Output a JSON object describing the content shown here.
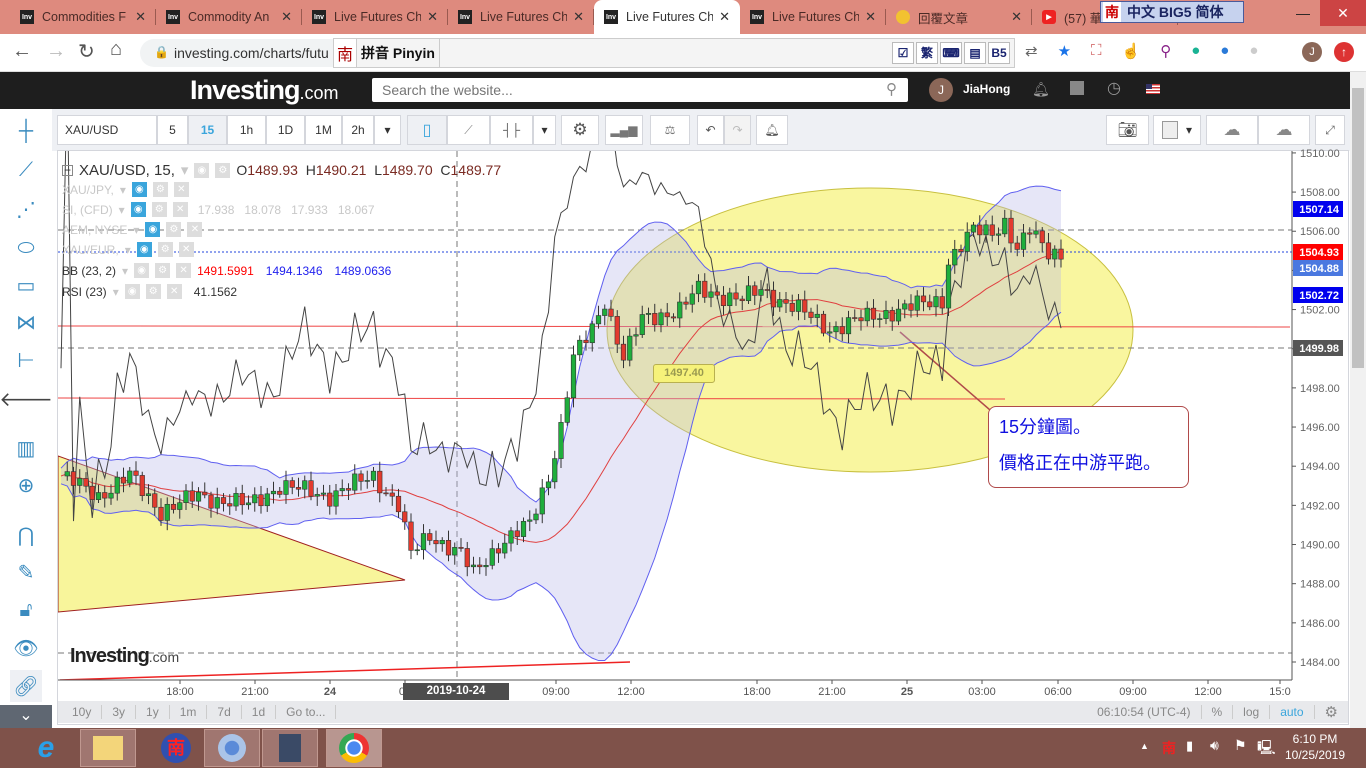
{
  "browser": {
    "tabs": [
      {
        "label": "Commodities F",
        "icon": "inv-icon"
      },
      {
        "label": "Commodity An",
        "icon": "inv-icon"
      },
      {
        "label": "Live Futures Ch",
        "icon": "inv-icon"
      },
      {
        "label": "Live Futures Ch",
        "icon": "inv-icon"
      },
      {
        "label": "Live Futures Ch",
        "icon": "inv-icon",
        "active": true
      },
      {
        "label": "Live Futures Ch",
        "icon": "inv-icon"
      },
      {
        "label": "回覆文章",
        "icon": "gem-icon"
      },
      {
        "label": "(57) 華",
        "icon": "youtube-icon"
      }
    ],
    "ime_bar": "中文 BIG5 简体",
    "ime_logo": "南",
    "url": "investing.com/charts/futu",
    "pinyin_label": "拼音 Pinyin",
    "pinyin_buttons": [
      "☑",
      "繁",
      "⌨",
      "▤",
      "B5"
    ],
    "profile_initial": "J"
  },
  "site": {
    "logo": "Investing",
    "logo_suffix": ".com",
    "search_placeholder": "Search the website...",
    "user_initial": "J",
    "username": "JiaHong"
  },
  "toolbar": {
    "symbol": "XAU/USD",
    "intervals": [
      "5",
      "15",
      "1h",
      "1D",
      "1M",
      "2h"
    ],
    "active_interval": "15"
  },
  "legend": {
    "main": {
      "symbol": "XAU/USD, 15,",
      "o_label": "O",
      "o": "1489.93",
      "h_label": "H",
      "h": "1490.21",
      "l_label": "L",
      "l": "1489.70",
      "c_label": "C",
      "c": "1489.77"
    },
    "compare": [
      {
        "symbol": "XAU/JPY,"
      },
      {
        "symbol": "SI, (CFD)",
        "values": [
          "17.938",
          "18.078",
          "17.933",
          "18.067"
        ]
      },
      {
        "symbol": "AEM, NYSE"
      },
      {
        "symbol": "XAU/EUR,"
      }
    ],
    "bb": {
      "label": "BB (23, 2)",
      "mid": "1491.5991",
      "upper": "1494.1346",
      "lower": "1489.0636"
    },
    "rsi": {
      "label": "RSI (23)",
      "value": "41.1562"
    }
  },
  "annotation": {
    "line1": "15分鐘圖。",
    "line2": "價格正在中游平跑。",
    "price_label": "1497.40"
  },
  "watermark": "Investing",
  "watermark_suffix": ".com",
  "crosshair_time": "2019-10-24 05:00:00",
  "bottom": {
    "ranges": [
      "10y",
      "3y",
      "1y",
      "1m",
      "7d",
      "1d",
      "Go to..."
    ],
    "clock": "06:10:54 (UTC-4)",
    "pct": "%",
    "log": "log",
    "auto": "auto"
  },
  "taskbar": {
    "time": "6:10 PM",
    "date": "10/25/2019"
  },
  "colors": {
    "up": "#1fae3c",
    "down": "#e23a2e",
    "bb_band": "#6060f0",
    "bb_mid": "#e04040",
    "highlight": "#f6f27a",
    "accent": "#3aa5dc"
  },
  "chart_data": {
    "type": "candlestick",
    "symbol": "XAU/USD",
    "interval": "15",
    "ylim": [
      1484,
      1510
    ],
    "y_ticks": [
      "1510.00",
      "1508.00",
      "1506.00",
      "1504.00",
      "1502.00",
      "1500.00",
      "1498.00",
      "1496.00",
      "1494.00",
      "1492.00",
      "1490.00",
      "1488.00",
      "1486.00",
      "1484.00"
    ],
    "x_ticks": [
      "18:00",
      "21:00",
      "24",
      "03",
      "09:00",
      "12:00",
      "18:00",
      "21:00",
      "25",
      "03:00",
      "06:00",
      "09:00",
      "12:00",
      "15:0"
    ],
    "price_labels": [
      {
        "value": "1507.14",
        "color": "#0000ee"
      },
      {
        "value": "1504.93",
        "color": "#ff0000"
      },
      {
        "value": "1504.88",
        "color": "#4a78e0"
      },
      {
        "value": "1502.72",
        "color": "#0000ee"
      },
      {
        "value": "1499.98",
        "color": "#555555"
      }
    ],
    "close_path": [
      [
        0,
        1493.5
      ],
      [
        6,
        1492.5
      ],
      [
        11,
        1493.5
      ],
      [
        16,
        1491.7
      ],
      [
        22,
        1492.5
      ],
      [
        30,
        1492
      ],
      [
        35,
        1493
      ],
      [
        43,
        1492.5
      ],
      [
        50,
        1493.5
      ],
      [
        54,
        1492
      ],
      [
        56,
        1489.5
      ],
      [
        59,
        1490.5
      ],
      [
        64,
        1489.5
      ],
      [
        66,
        1488.5
      ],
      [
        70,
        1490
      ],
      [
        75,
        1491
      ],
      [
        78,
        1493.5
      ],
      [
        80,
        1496
      ],
      [
        82,
        1499.5
      ],
      [
        85,
        1501
      ],
      [
        87,
        1502.5
      ],
      [
        90,
        1499.5
      ],
      [
        93,
        1501.5
      ],
      [
        99,
        1502
      ],
      [
        102,
        1503
      ],
      [
        109,
        1502.5
      ],
      [
        112,
        1503
      ],
      [
        118,
        1502
      ],
      [
        123,
        1501
      ],
      [
        128,
        1501.5
      ],
      [
        134,
        1502
      ],
      [
        141,
        1502.5
      ],
      [
        142,
        1504.5
      ],
      [
        146,
        1506
      ],
      [
        149,
        1506
      ],
      [
        151,
        1506.5
      ],
      [
        153,
        1505
      ],
      [
        155,
        1506
      ],
      [
        158,
        1505
      ],
      [
        160,
        1504.9
      ]
    ],
    "horizontal_lines": [
      1506,
      1504.93,
      1501,
      1500,
      1497.4,
      1484.45
    ],
    "indicators": [
      "BB (23, 2)",
      "RSI (23)"
    ]
  }
}
